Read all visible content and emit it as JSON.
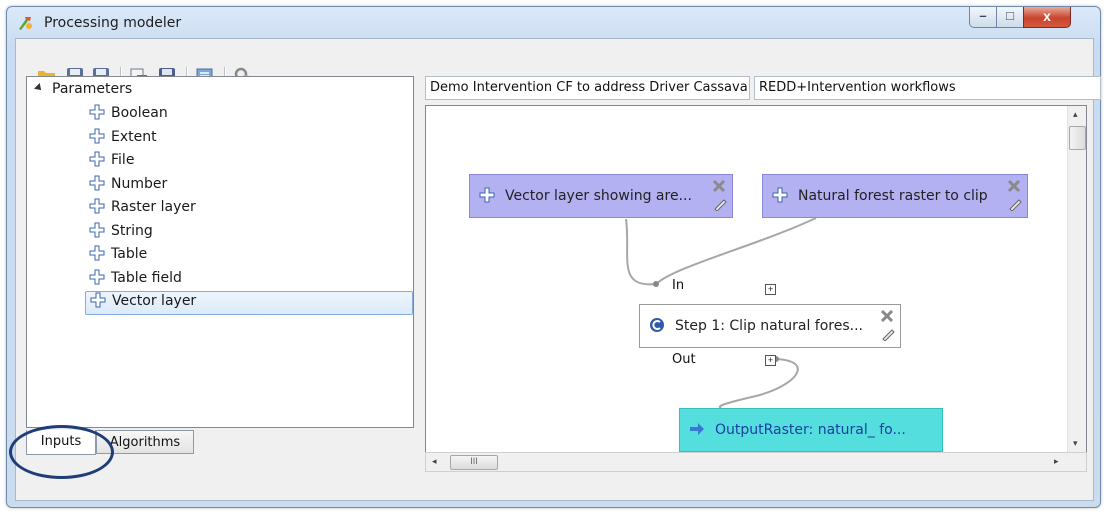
{
  "window": {
    "title": "Processing modeler",
    "controls": {
      "minimize": "–",
      "maximize": "□",
      "close": "x"
    }
  },
  "toolbar": {
    "icons": [
      "open-model-icon",
      "save-model-icon",
      "save-as-icon",
      "export-image-icon",
      "save-to-processing-icon",
      "edit-help-icon",
      "run-model-icon"
    ]
  },
  "left": {
    "root_label": "Parameters",
    "items": [
      {
        "label": "Boolean"
      },
      {
        "label": "Extent"
      },
      {
        "label": "File"
      },
      {
        "label": "Number"
      },
      {
        "label": "Raster layer"
      },
      {
        "label": "String"
      },
      {
        "label": "Table"
      },
      {
        "label": "Table field"
      },
      {
        "label": "Vector layer",
        "selected": true
      }
    ],
    "tabs": [
      {
        "label": "Inputs",
        "active": true
      },
      {
        "label": "Algorithms",
        "active": false
      }
    ]
  },
  "model": {
    "name": "Demo Intervention CF to address Driver Cassava",
    "group": "REDD+Intervention workflows"
  },
  "canvas": {
    "nodes": {
      "input1": "Vector layer showing are...",
      "input2": "Natural forest raster to clip",
      "step": "Step 1: Clip natural fores...",
      "output": "OutputRaster: natural_ fo..."
    },
    "ports": {
      "in": "In",
      "out": "Out",
      "expand": "+"
    },
    "scroll": {
      "h_grip": "III",
      "left": "◂",
      "right": "▸",
      "up": "▴",
      "down": "▾"
    }
  },
  "colors": {
    "input_node": "#b3b1f2",
    "output_node": "#54dede",
    "output_text": "#1b3fa1",
    "selection": "#84acdd",
    "highlight_ring": "#1f3d78"
  }
}
